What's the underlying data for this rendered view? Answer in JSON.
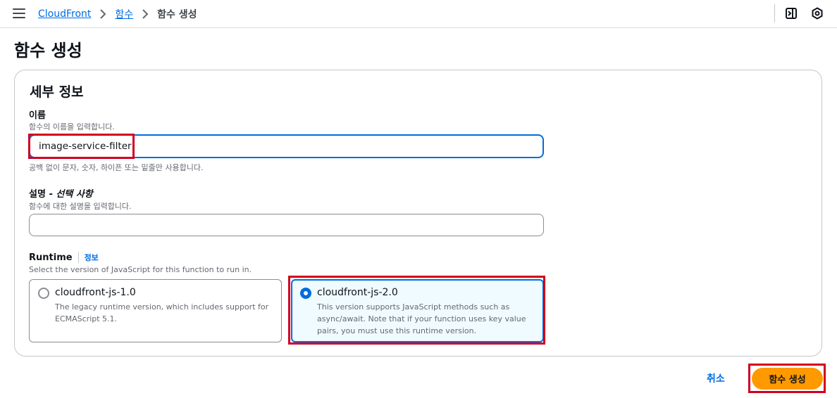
{
  "breadcrumb": {
    "items": [
      "CloudFront",
      "함수"
    ],
    "current": "함수 생성"
  },
  "page": {
    "title": "함수 생성"
  },
  "details": {
    "section_title": "세부 정보",
    "name": {
      "label": "이름",
      "description": "함수의 이름을 입력합니다.",
      "value": "image-service-filter",
      "constraint": "공백 없이 문자, 숫자, 하이픈 또는 밑줄만 사용합니다."
    },
    "description_field": {
      "label": "설명 - ",
      "label_optional": "선택 사항",
      "description": "함수에 대한 설명을 입력합니다.",
      "value": ""
    },
    "runtime": {
      "label": "Runtime",
      "info_link": "정보",
      "description": "Select the version of JavaScript for this function to run in.",
      "options": [
        {
          "title": "cloudfront-js-1.0",
          "description": "The legacy runtime version, which includes support for ECMAScript 5.1.",
          "selected": false
        },
        {
          "title": "cloudfront-js-2.0",
          "description": "This version supports JavaScript methods such as async/await. Note that if your function uses key value pairs, you must use this runtime version.",
          "selected": true
        }
      ]
    }
  },
  "footer": {
    "cancel_label": "취소",
    "submit_label": "함수 생성"
  },
  "icons": {
    "menu": "menu-icon",
    "breadcrumb_separator": "chevron-right-icon",
    "panel": "split-panel-icon",
    "settings": "hexagon-settings-icon"
  },
  "colors": {
    "link": "#006ce0",
    "primary_button": "#ff9900",
    "highlight_box": "#d1001f",
    "selected_tile_bg": "#f0fbff"
  }
}
